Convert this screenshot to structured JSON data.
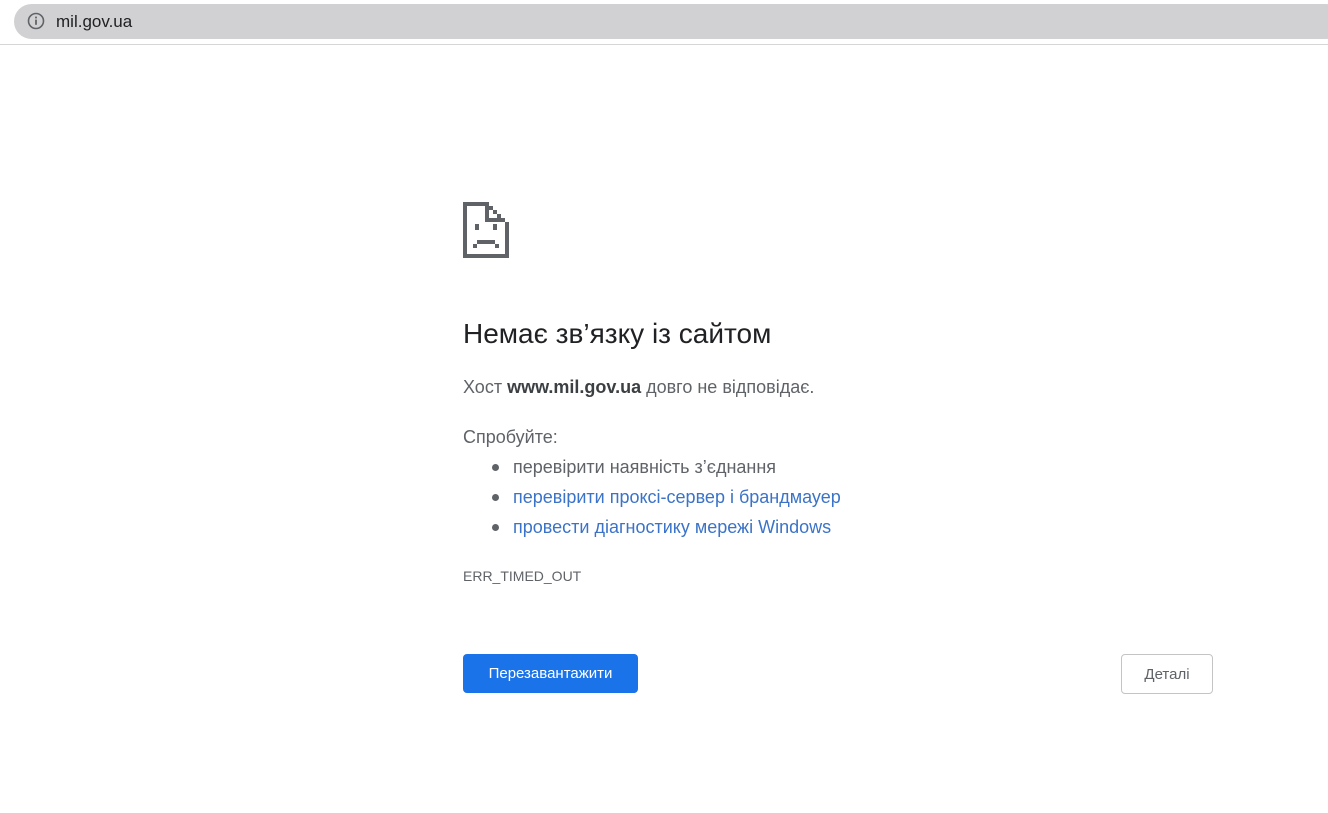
{
  "address_bar": {
    "url": "mil.gov.ua",
    "icon": "info-icon"
  },
  "error_page": {
    "icon": "sad-page-icon",
    "heading": "Немає зв’язку із сайтом",
    "host_prefix": "Хост",
    "host": "www.mil.gov.ua",
    "host_suffix": "довго не відповідає.",
    "try_label": "Спробуйте:",
    "suggestions": [
      {
        "text": "перевірити наявність з’єднання",
        "link": false
      },
      {
        "text": "перевірити проксі-сервер і брандмауер",
        "link": true
      },
      {
        "text": "провести діагностику мережі Windows",
        "link": true
      }
    ],
    "error_code": "ERR_TIMED_OUT",
    "reload_label": "Перезавантажити",
    "details_label": "Деталі"
  },
  "colors": {
    "primary_button": "#1a73e8",
    "link": "#3b73c8",
    "text_secondary": "#5f6368",
    "heading": "#202124",
    "omnibox": "#d1d1d3"
  }
}
